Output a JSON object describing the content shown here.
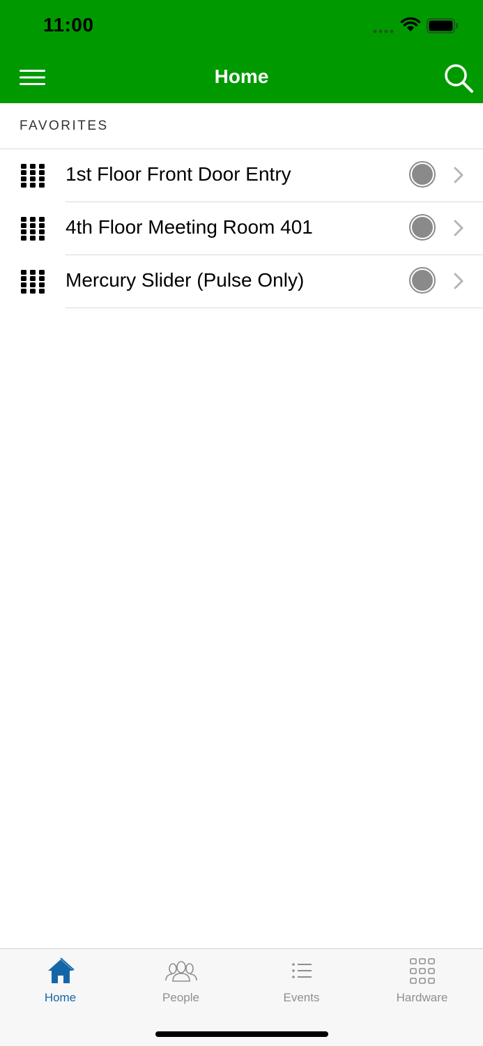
{
  "status_bar": {
    "time": "11:00"
  },
  "nav": {
    "title": "Home",
    "menu_icon": "hamburger-menu-icon",
    "search_icon": "search-icon"
  },
  "colors": {
    "header_green": "#009a00",
    "tab_active": "#1566a8",
    "tab_inactive": "#8e8e8e",
    "status_dot": "#8a8a8a"
  },
  "favorites": {
    "header": "FAVORITES",
    "items": [
      {
        "label": "1st Floor Front Door Entry",
        "icon": "keypad-icon"
      },
      {
        "label": "4th Floor Meeting Room 401",
        "icon": "keypad-icon"
      },
      {
        "label": "Mercury Slider (Pulse Only)",
        "icon": "keypad-icon"
      }
    ]
  },
  "tabs": [
    {
      "label": "Home",
      "icon": "home-icon",
      "active": true
    },
    {
      "label": "People",
      "icon": "people-icon",
      "active": false
    },
    {
      "label": "Events",
      "icon": "list-icon",
      "active": false
    },
    {
      "label": "Hardware",
      "icon": "grid-icon",
      "active": false
    }
  ]
}
